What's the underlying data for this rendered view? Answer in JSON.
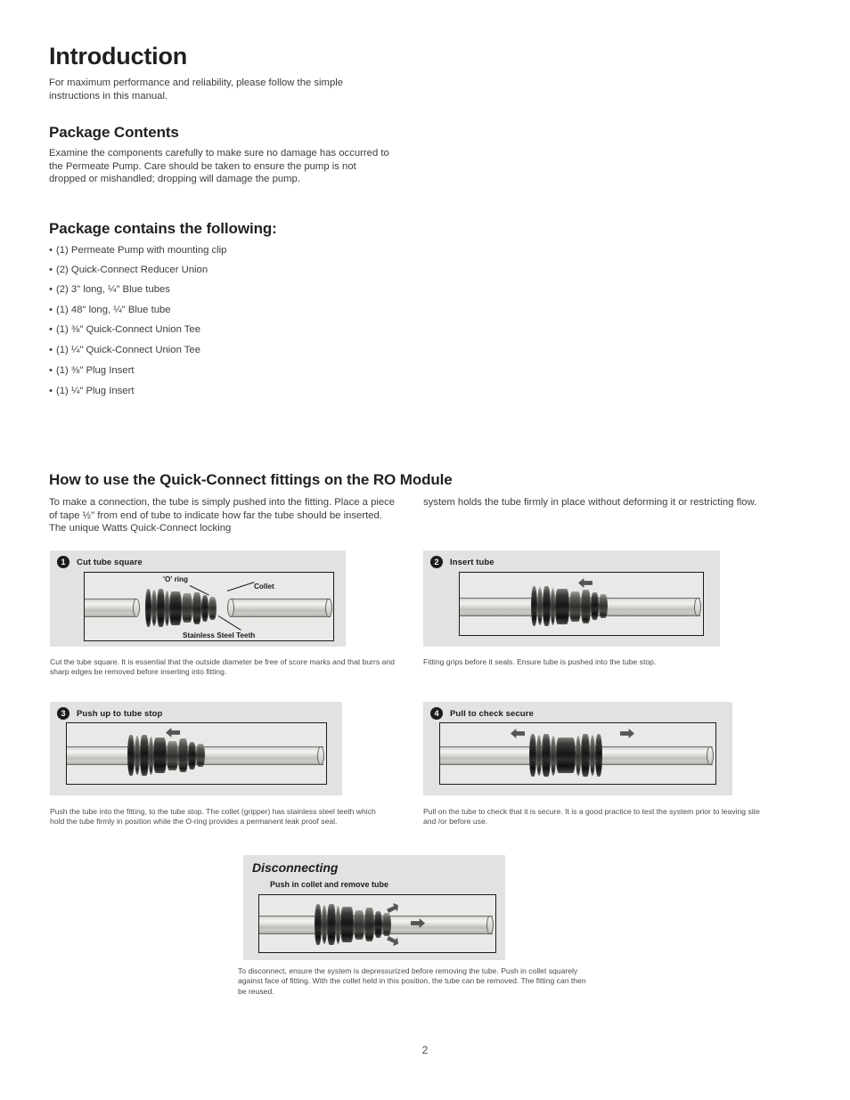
{
  "document": {
    "page_number": "2"
  },
  "intro": {
    "heading": "Introduction",
    "paragraph": "For maximum performance and reliability, please follow the simple instructions in this manual."
  },
  "package_contents": {
    "heading": "Package Contents",
    "paragraph": "Examine the components carefully to make sure no damage has occurred to the Permeate Pump. Care should be taken to ensure the pump is not dropped or mishandled; dropping will damage the pump."
  },
  "package_list": {
    "heading": "Package contains the following:",
    "items": [
      "(1) Permeate Pump with mounting clip",
      "(2) Quick-Connect Reducer Union",
      "(2) 3\" long, ¼\" Blue tubes",
      "(1) 48\" long, ¼\" Blue tube",
      "(1) ⅜\" Quick-Connect Union Tee",
      "(1) ¼\" Quick-Connect Union Tee",
      "(1) ⅜\" Plug Insert",
      "(1) ¼\" Plug Insert"
    ]
  },
  "quick_connect": {
    "heading": "How to use the Quick-Connect fittings on the RO Module",
    "column_left": "To make a connection, the tube is simply pushed into the fitting. Place a piece of tape ½\" from end of tube to indicate how far the tube should be inserted. The unique Watts Quick-Connect locking",
    "column_right": "system holds the tube firmly in place without deforming it or restricting flow."
  },
  "figures": [
    {
      "number": "1",
      "title": "Cut tube square",
      "callouts": [
        "'O' ring",
        "Collet",
        "Stainless Steel Teeth"
      ],
      "caption": "Cut the tube square.  It is essential that the outside diameter be free of score marks and that burrs and sharp edges be removed before inserting into fitting."
    },
    {
      "number": "2",
      "title": "Insert tube",
      "caption": "Fitting grips before it seals.  Ensure tube is pushed into the tube stop."
    },
    {
      "number": "3",
      "title": "Push up to tube stop",
      "caption": "Push the tube into the fitting, to the tube stop.  The collet (gripper) has stainless steel teeth which hold the tube firmly in position while the O-ring provides a permanent leak proof seal."
    },
    {
      "number": "4",
      "title": "Pull to check secure",
      "caption": "Pull on the tube to check that it is secure.  It is a good practice to test the system prior to leaving site and /or before use."
    }
  ],
  "disconnecting": {
    "title": "Disconnecting",
    "subtitle": "Push in collet and remove tube",
    "caption": "To disconnect, ensure the system is depressurized before removing the tube.  Push in collet squarely against face of fitting.  With the collet held in this position, the tube can be removed.  The fitting can then be reused."
  }
}
